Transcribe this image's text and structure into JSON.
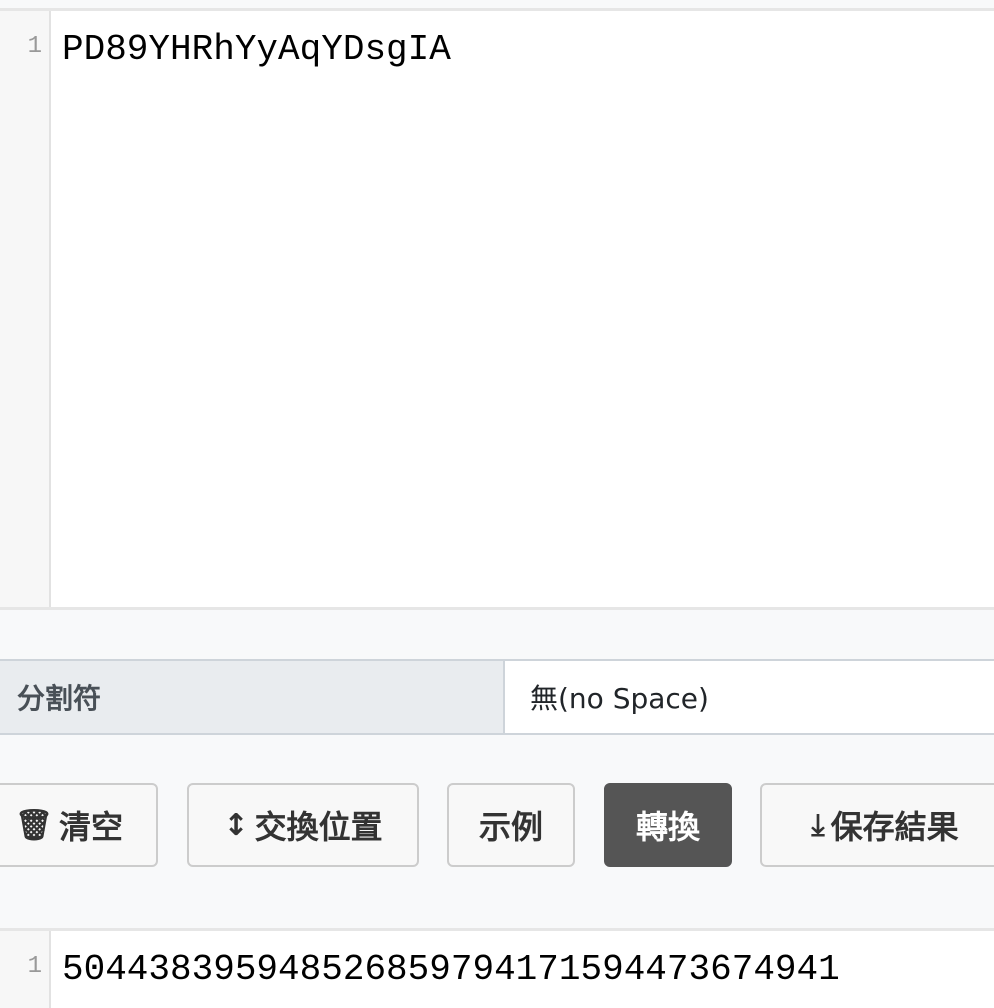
{
  "input_editor": {
    "line_number": "1",
    "text": "PD89YHRhYyAqYDsgIA"
  },
  "separator": {
    "label": "分割符",
    "value": "無(no Space)"
  },
  "buttons": {
    "clear": "清空",
    "swap": "交換位置",
    "example": "示例",
    "convert": "轉換",
    "save": "保存結果"
  },
  "output_editor": {
    "line_number": "1",
    "text": "504438395948526859794171594473674941"
  },
  "colors": {
    "convert_button": "#555555",
    "label_bg": "#e9ecef"
  }
}
